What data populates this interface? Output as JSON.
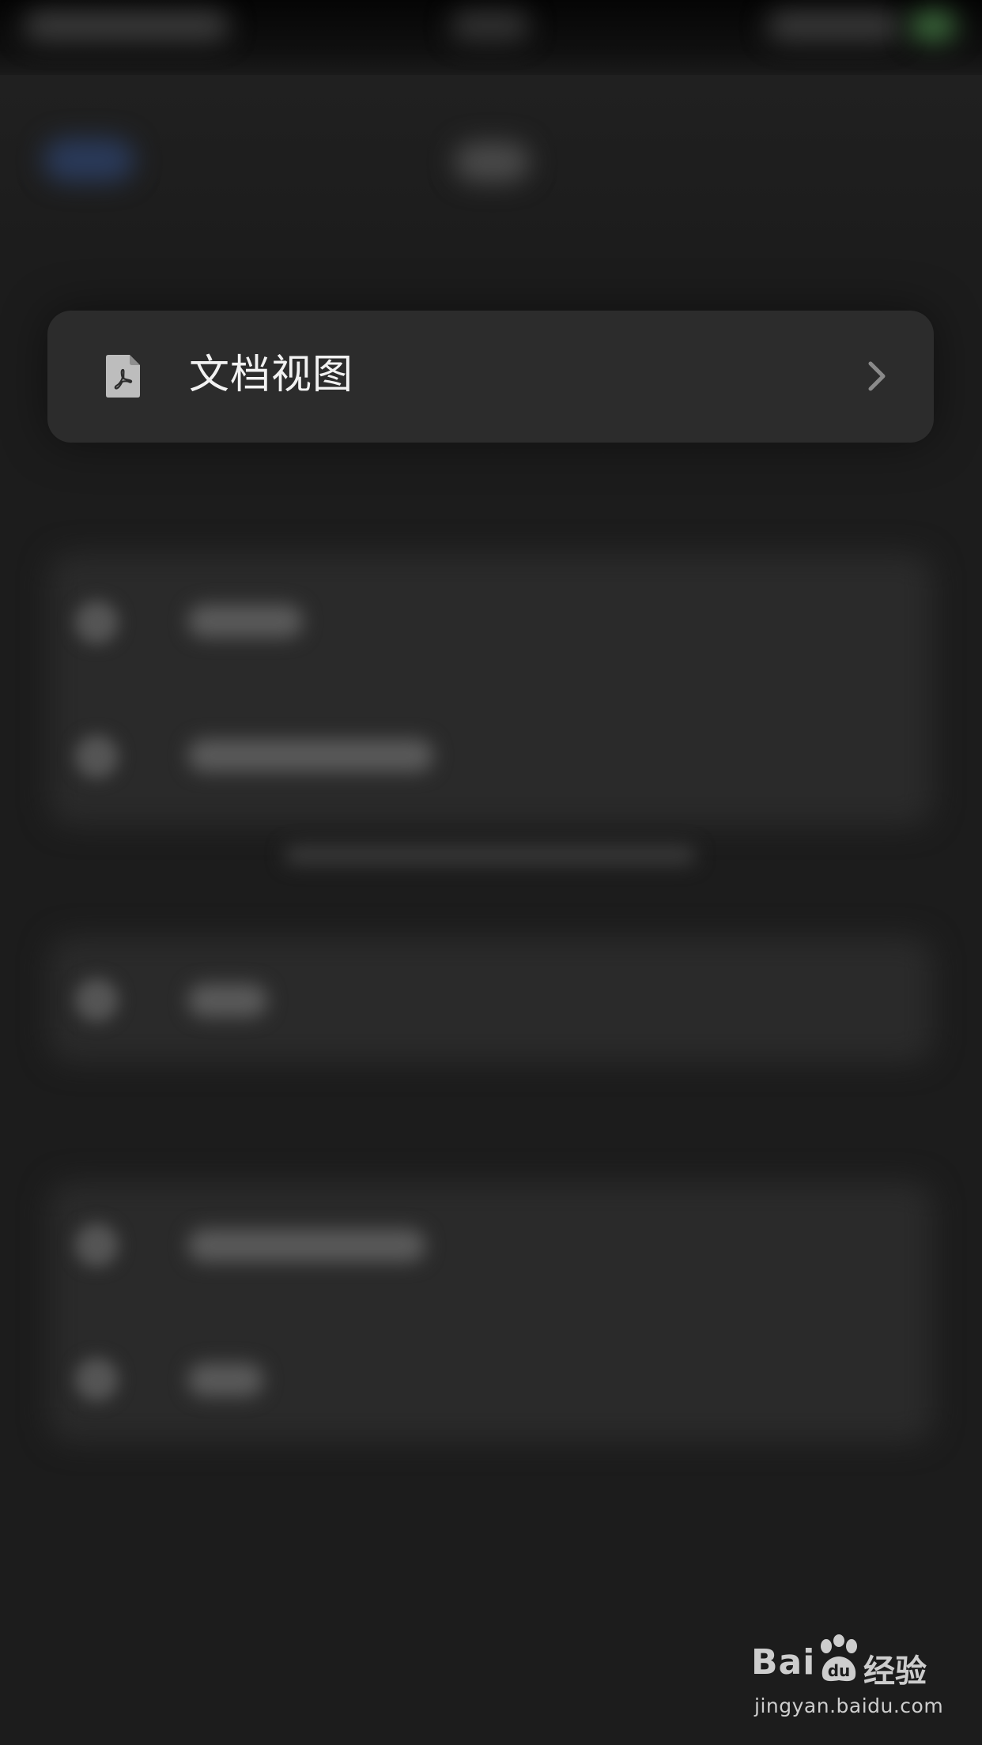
{
  "menu_item": {
    "label": "文档视图",
    "icon": "pdf-document-icon"
  },
  "watermark": {
    "brand": "Bai",
    "brand_cn": "经验",
    "url": "jingyan.baidu.com"
  },
  "colors": {
    "background": "#1c1c1c",
    "card": "#2c2c2c",
    "label": "#f2f2f2",
    "chevron": "#8a8a8a"
  }
}
